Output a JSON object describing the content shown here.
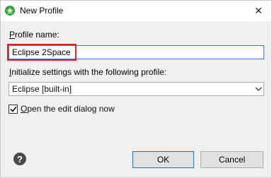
{
  "window": {
    "title": "New Profile",
    "close_glyph": "✕"
  },
  "form": {
    "profile_name_label_hotkey": "P",
    "profile_name_label_rest": "rofile name:",
    "profile_name_value": "Eclipse 2Space",
    "init_label_hotkey": "I",
    "init_label_rest": "nitialize settings with the following profile:",
    "selected_profile": "Eclipse [built-in]",
    "open_edit_hotkey": "O",
    "open_edit_rest": "pen the edit dialog now",
    "open_edit_checked": true
  },
  "buttons": {
    "ok": "OK",
    "cancel": "Cancel",
    "help": "?"
  },
  "icons": {
    "app": "eclipse-icon",
    "dropdown": "chevron-down-icon",
    "checkmark": "checkmark-icon"
  },
  "colors": {
    "focus_border": "#3c74d9",
    "highlight": "#e02020",
    "app_icon": "#2e9b3f"
  }
}
